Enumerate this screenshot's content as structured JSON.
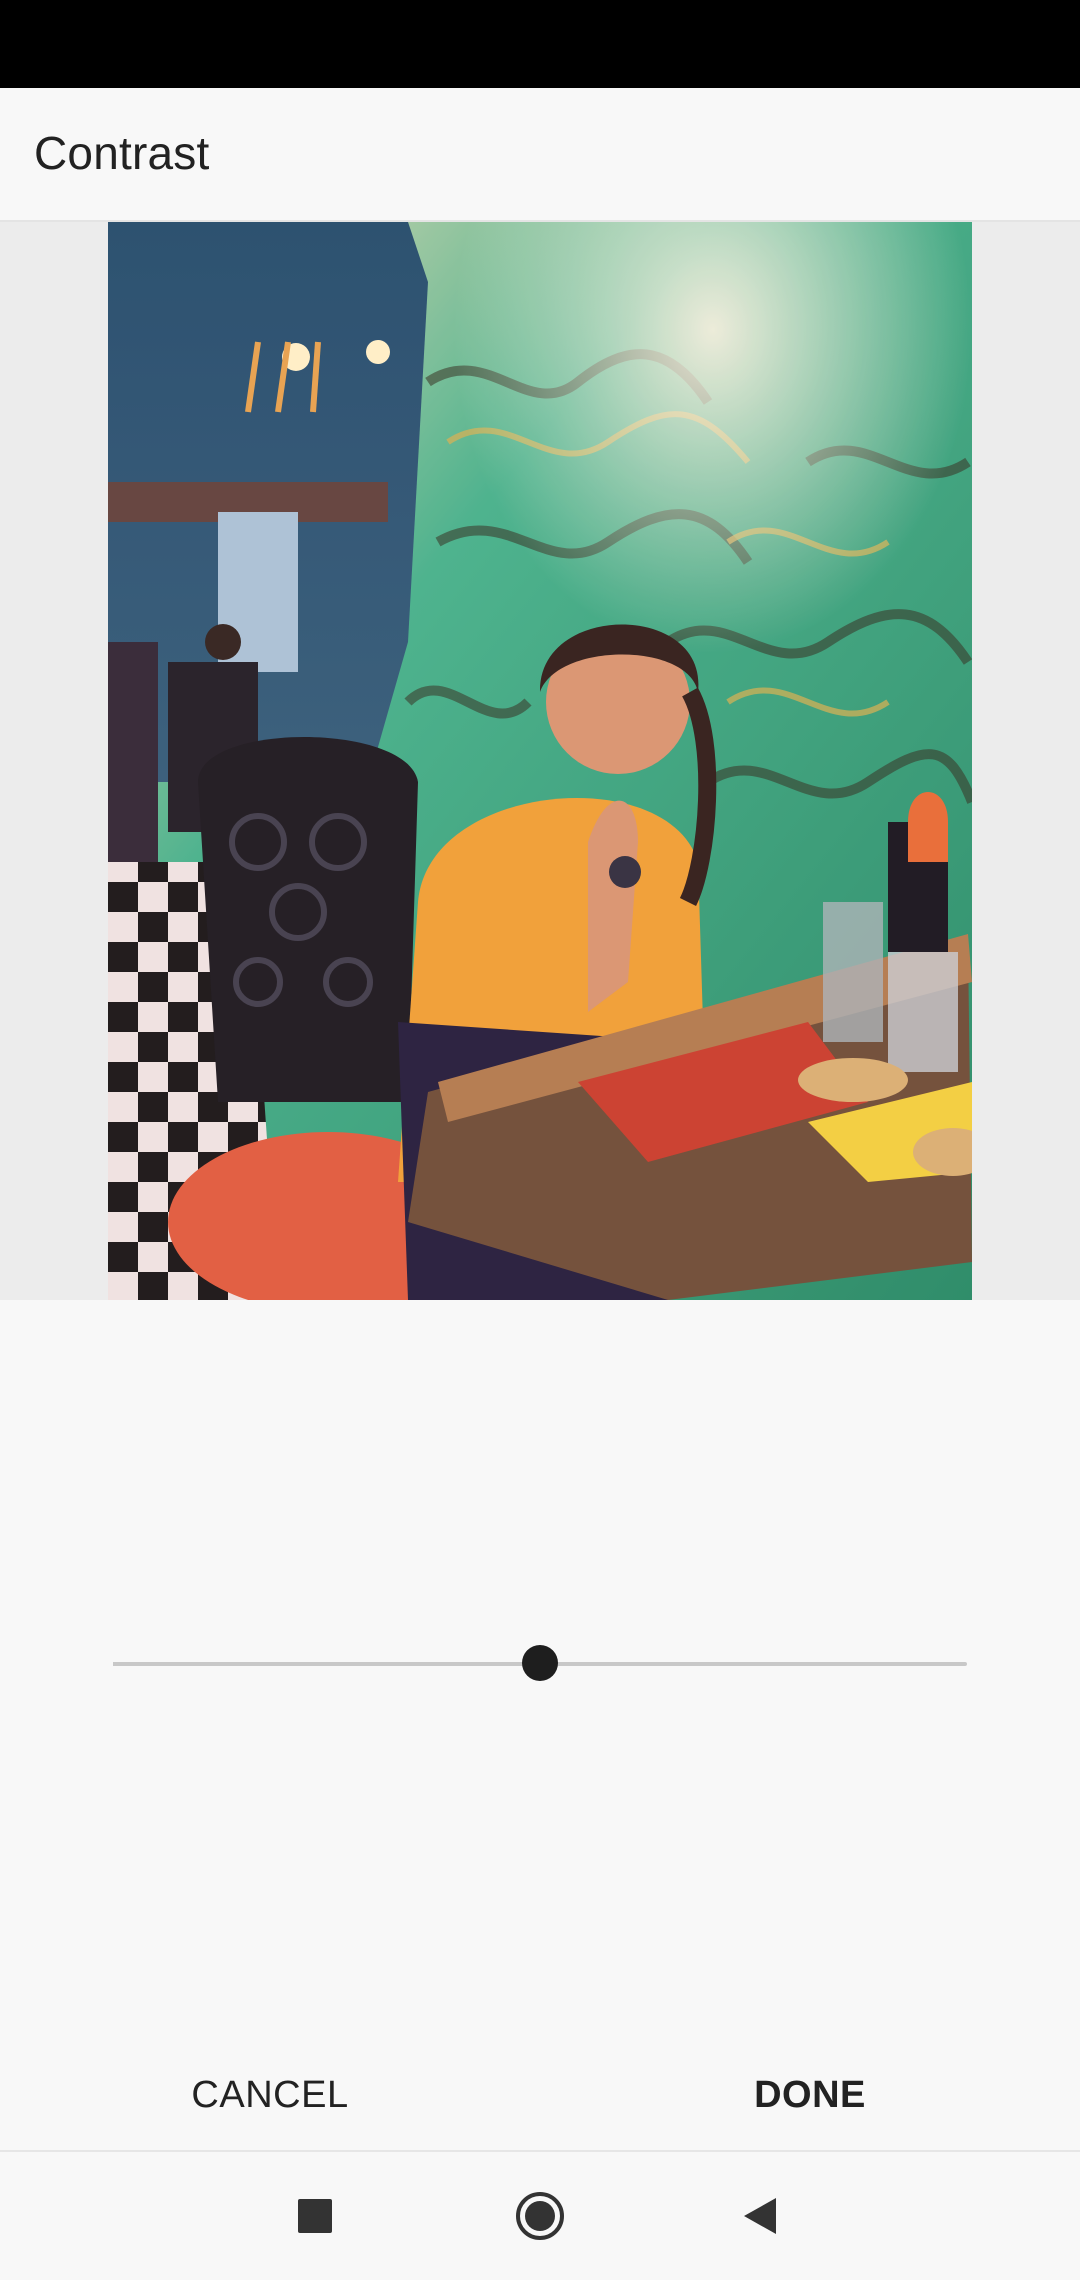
{
  "app_bar": {
    "title": "Contrast"
  },
  "photo": {
    "description_icon": "photo-preview"
  },
  "slider": {
    "value": 0.5
  },
  "actions": {
    "cancel_label": "CANCEL",
    "done_label": "DONE"
  },
  "nav": {
    "recents_icon": "square-icon",
    "home_icon": "circle-icon",
    "back_icon": "triangle-back-icon"
  },
  "colors": {
    "status_bar": "#000000",
    "background": "#f8f8f8",
    "preview_bg": "#ececec",
    "thumb": "#1e1e1e",
    "track": "#c8c8c8"
  }
}
